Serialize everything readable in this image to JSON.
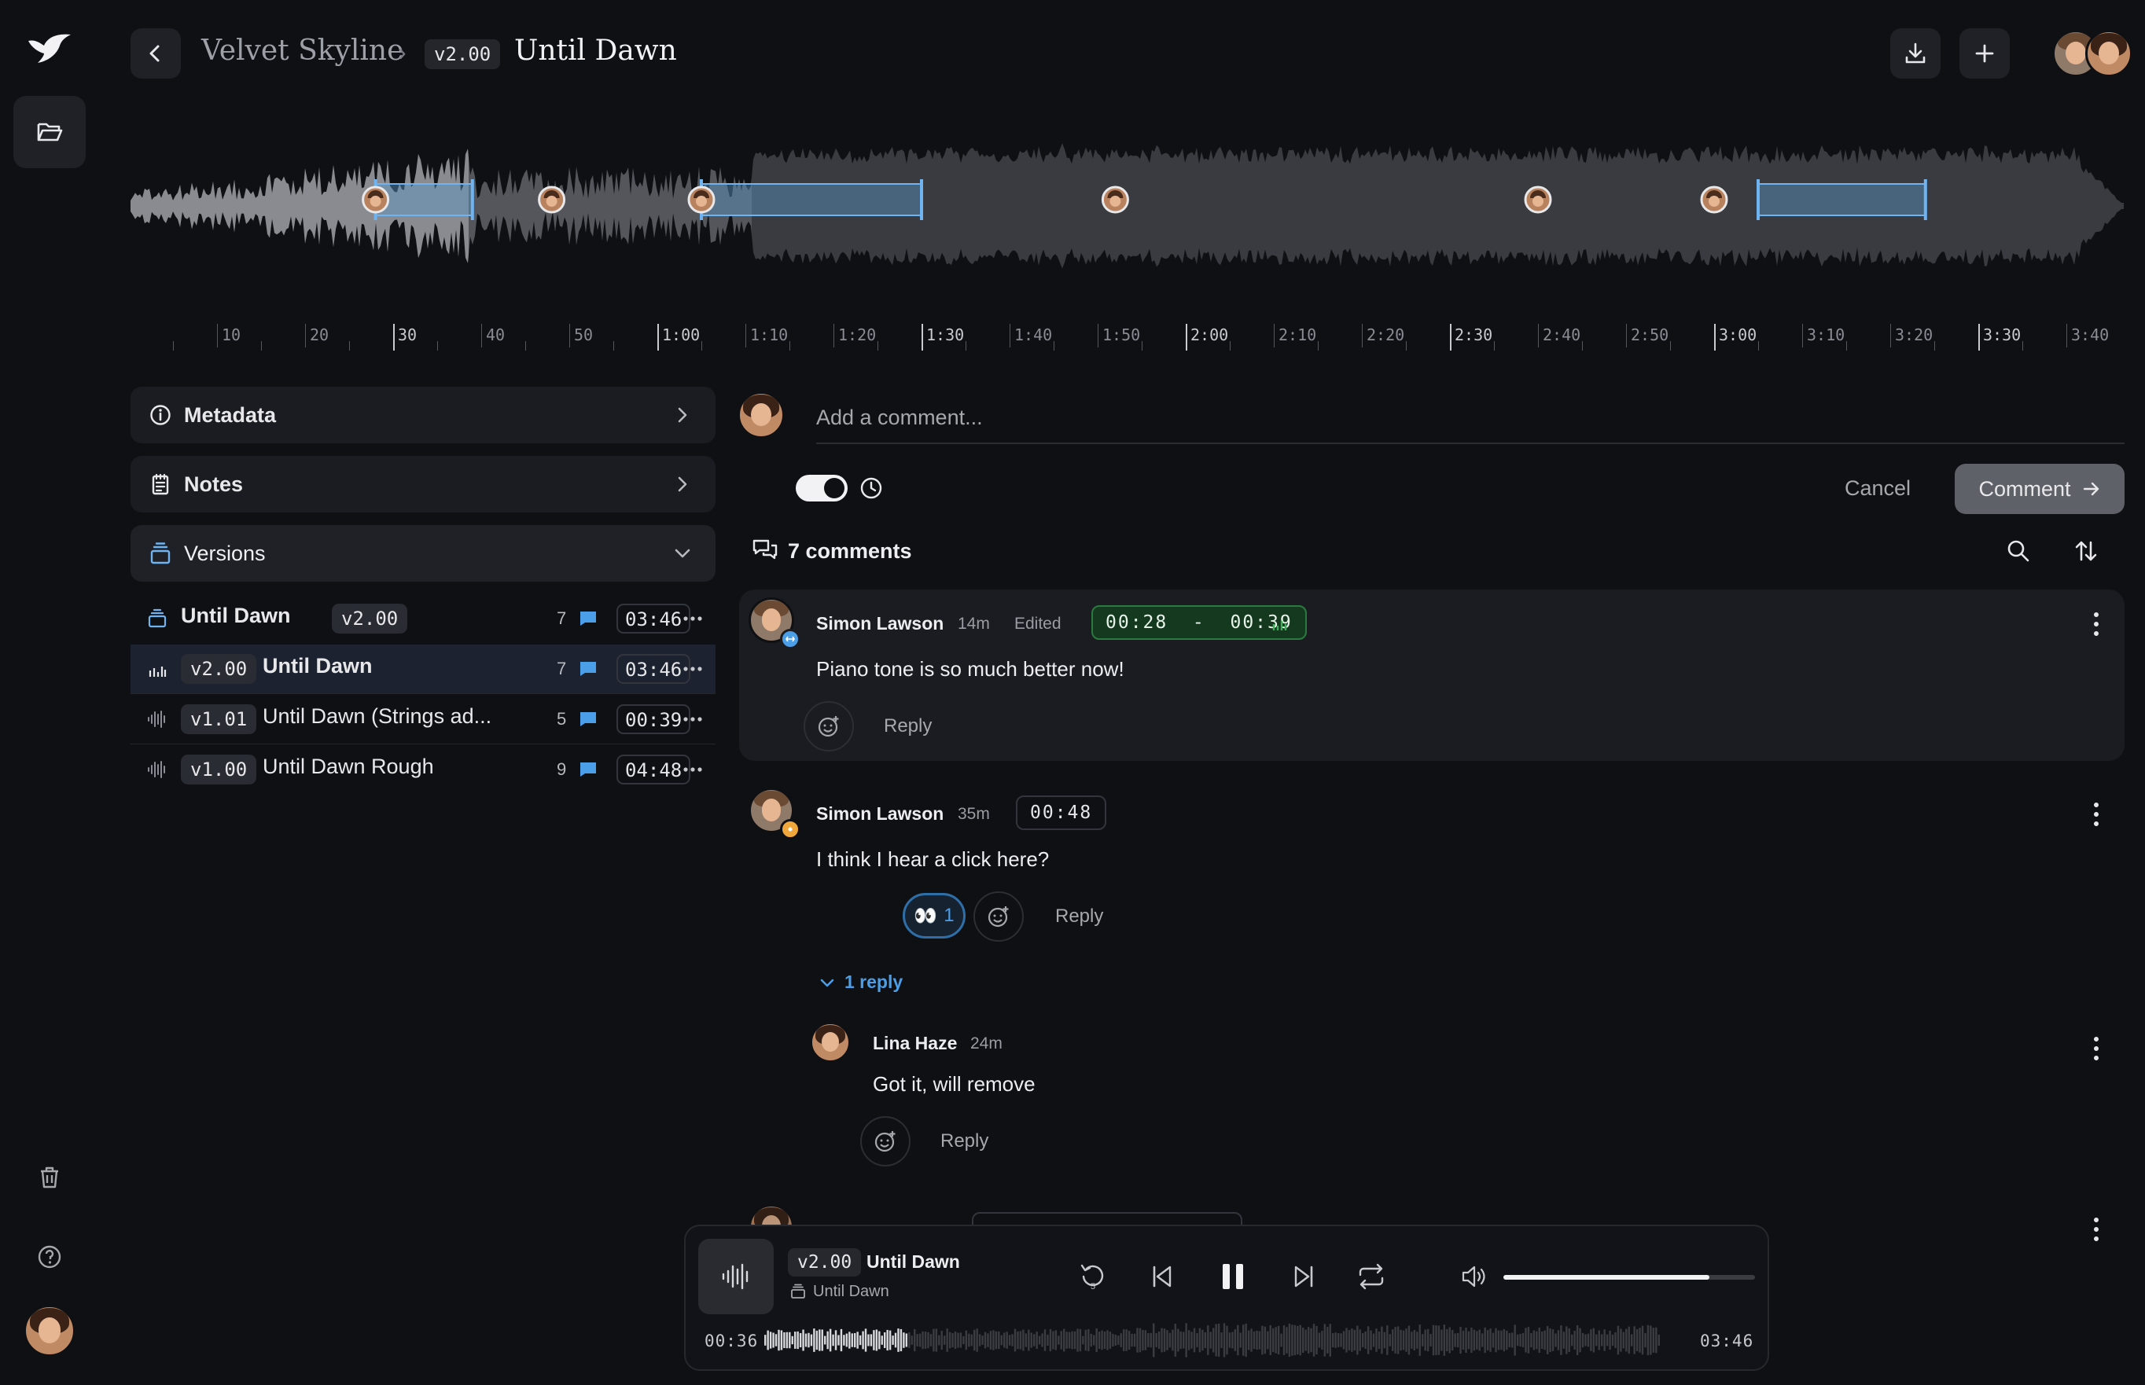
{
  "header": {
    "project": "Velvet Skyline",
    "separator": "›",
    "version": "v2.00",
    "track": "Until Dawn",
    "buttons": [
      "download-icon",
      "plus-icon"
    ]
  },
  "colors": {
    "background": "#0f1014",
    "panel": "#1b1c21",
    "accent_blue": "#4b9ee8",
    "timecode_green": "#2a7a3f",
    "selected_row": "#1c2230"
  },
  "timeline": {
    "ruler_labels": [
      "10",
      "20",
      "30",
      "40",
      "50",
      "1:00",
      "1:10",
      "1:20",
      "1:30",
      "1:40",
      "1:50",
      "2:00",
      "2:10",
      "2:20",
      "2:30",
      "2:40",
      "2:50",
      "3:00",
      "3:10",
      "3:20",
      "3:30",
      "3:40"
    ],
    "duration_seconds": 226,
    "comment_markers_seconds": [
      28,
      48,
      65,
      112,
      160,
      180
    ],
    "comment_regions_seconds": [
      [
        28,
        39
      ],
      [
        65,
        90
      ],
      [
        185,
        204
      ]
    ]
  },
  "panels": {
    "metadata": "Metadata",
    "notes": "Notes",
    "versions": "Versions"
  },
  "versions": [
    {
      "badge": "v2.00",
      "name": "Until Dawn",
      "count": "7",
      "duration": "03:46",
      "kind": "stack",
      "bold": true,
      "badge_after": true
    },
    {
      "badge": "v2.00",
      "name": "Until Dawn",
      "count": "7",
      "duration": "03:46",
      "kind": "bars",
      "bold": true,
      "badge_after": false
    },
    {
      "badge": "v1.01",
      "name": "Until Dawn (Strings ad...",
      "count": "5",
      "duration": "00:39",
      "kind": "wave",
      "bold": false,
      "badge_after": false
    },
    {
      "badge": "v1.00",
      "name": "Until Dawn Rough",
      "count": "9",
      "duration": "04:48",
      "kind": "wave",
      "bold": false,
      "badge_after": false
    }
  ],
  "composer": {
    "placeholder": "Add a comment...",
    "cancel": "Cancel",
    "submit": "Comment"
  },
  "comments_header": {
    "count_label": "7 comments"
  },
  "comments": [
    {
      "user": "Simon Lawson",
      "ago": "14m",
      "edited": "Edited",
      "timecode": "00:28  -  00:39",
      "text": "Piano tone is so much better now!",
      "reply": "Reply"
    },
    {
      "user": "Simon Lawson",
      "ago": "35m",
      "timecode": "00:48",
      "text": "I think I hear a click here?",
      "reaction_emoji": "👀",
      "reaction_count": "1",
      "reply": "Reply",
      "replies_label": "1 reply"
    },
    {
      "user": "Lina Haze",
      "ago": "24m",
      "text": "Got it, will remove",
      "reply": "Reply"
    }
  ],
  "player": {
    "version": "v2.00",
    "title": "Until Dawn",
    "subtitle": "Until Dawn",
    "elapsed": "00:36",
    "total": "03:46",
    "volume": 0.82,
    "progress": 0.16
  }
}
